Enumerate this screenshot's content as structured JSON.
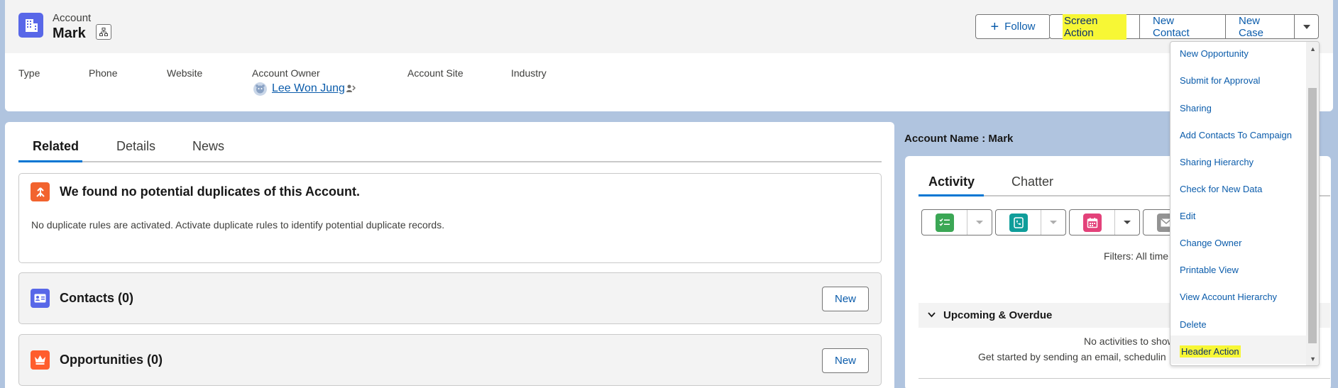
{
  "header": {
    "object_type": "Account",
    "record_name": "Mark",
    "follow_label": "Follow",
    "actions": [
      "Screen Action",
      "New Contact",
      "New Case"
    ],
    "fields": {
      "type_label": "Type",
      "phone_label": "Phone",
      "website_label": "Website",
      "owner_label": "Account Owner",
      "owner_value": "Lee Won Jung",
      "site_label": "Account Site",
      "industry_label": "Industry"
    }
  },
  "dropdown": {
    "items": [
      "New Opportunity",
      "Submit for Approval",
      "Sharing",
      "Add Contacts To Campaign",
      "Sharing Hierarchy",
      "Check for New Data",
      "Edit",
      "Change Owner",
      "Printable View",
      "View Account Hierarchy",
      "Delete",
      "Header Action"
    ]
  },
  "main": {
    "tabs": [
      "Related",
      "Details",
      "News"
    ],
    "duplicates": {
      "title": "We found no potential duplicates of this Account.",
      "body": "No duplicate rules are activated. Activate duplicate rules to identify potential duplicate records."
    },
    "contacts": {
      "title": "Contacts (0)",
      "new_label": "New"
    },
    "opportunities": {
      "title": "Opportunities (0)",
      "new_label": "New"
    }
  },
  "right": {
    "account_name_label": "Account Name : Mark",
    "tabs": [
      "Activity",
      "Chatter"
    ],
    "filters_text": "Filters: All time",
    "upcoming_label": "Upcoming & Overdue",
    "no_activities": "No activities to show.",
    "get_started": "Get started by sending an email, schedulin"
  },
  "colors": {
    "background": "#b0c4df",
    "brand_blue": "#0176d3",
    "link_blue": "#0b5cab",
    "account_icon": "#5867e8",
    "highlight": "#f7f735",
    "task_green": "#3ba755",
    "call_teal": "#0f9d9a",
    "event_pink": "#e3427a",
    "duplicate_orange": "#f2632e"
  },
  "icons": {
    "account": "building-icon",
    "hierarchy": "hierarchy-icon",
    "duplicate": "merge-icon",
    "contacts": "contact-card-icon",
    "opportunities": "crown-icon"
  }
}
